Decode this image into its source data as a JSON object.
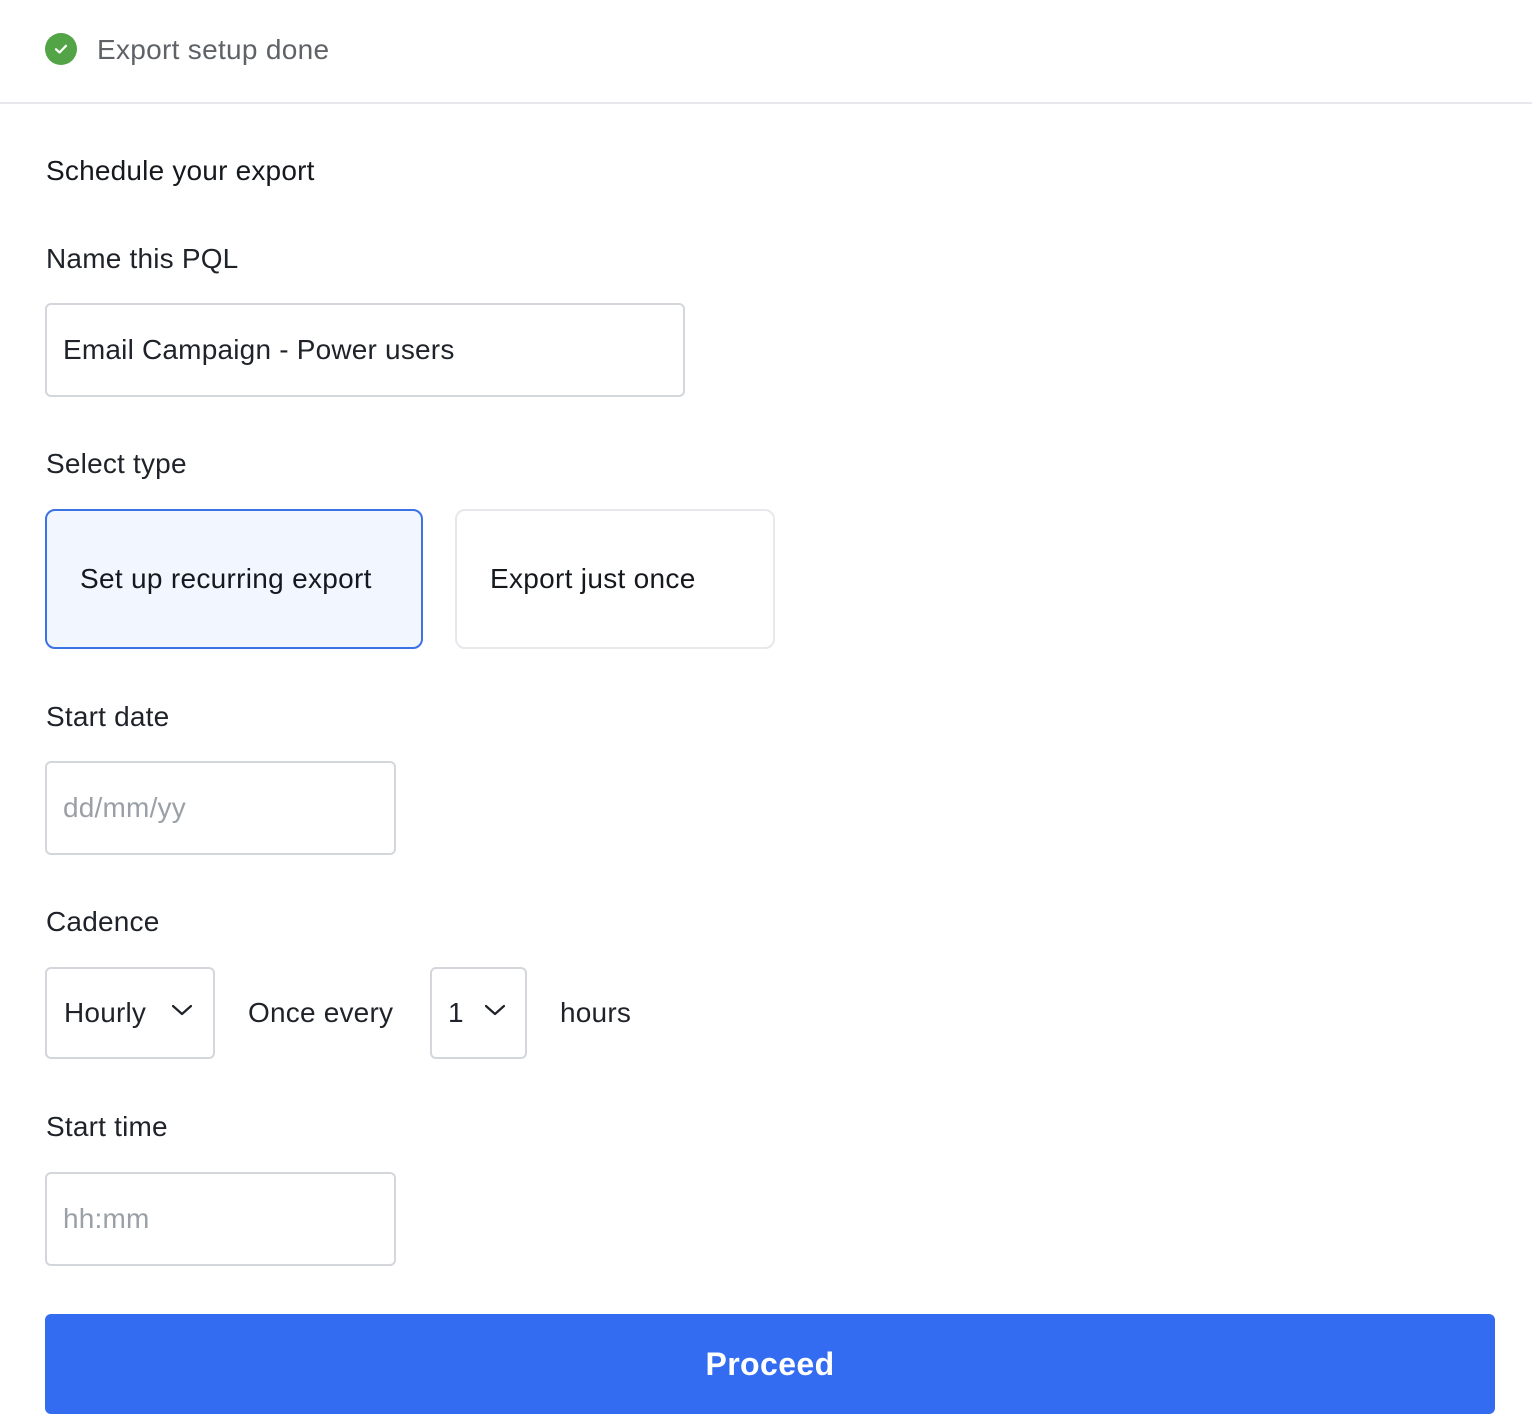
{
  "header": {
    "status_icon": "check-circle-icon",
    "status_color": "#52a447",
    "title": "Export setup done"
  },
  "form": {
    "section_title": "Schedule your export",
    "name": {
      "label": "Name this PQL",
      "value": "Email Campaign - Power users"
    },
    "type": {
      "label": "Select type",
      "options": [
        {
          "label": "Set up recurring export",
          "selected": true
        },
        {
          "label": "Export just once",
          "selected": false
        }
      ]
    },
    "start_date": {
      "label": "Start date",
      "placeholder": "dd/mm/yy"
    },
    "cadence": {
      "label": "Cadence",
      "frequency": "Hourly",
      "once_every_label": "Once every",
      "interval": "1",
      "unit": "hours"
    },
    "start_time": {
      "label": "Start time",
      "placeholder": "hh:mm"
    },
    "proceed_label": "Proceed"
  },
  "colors": {
    "accent": "#336cf0",
    "selected_border": "#3b72e6",
    "selected_bg": "#f2f6fe",
    "success": "#52a447"
  }
}
